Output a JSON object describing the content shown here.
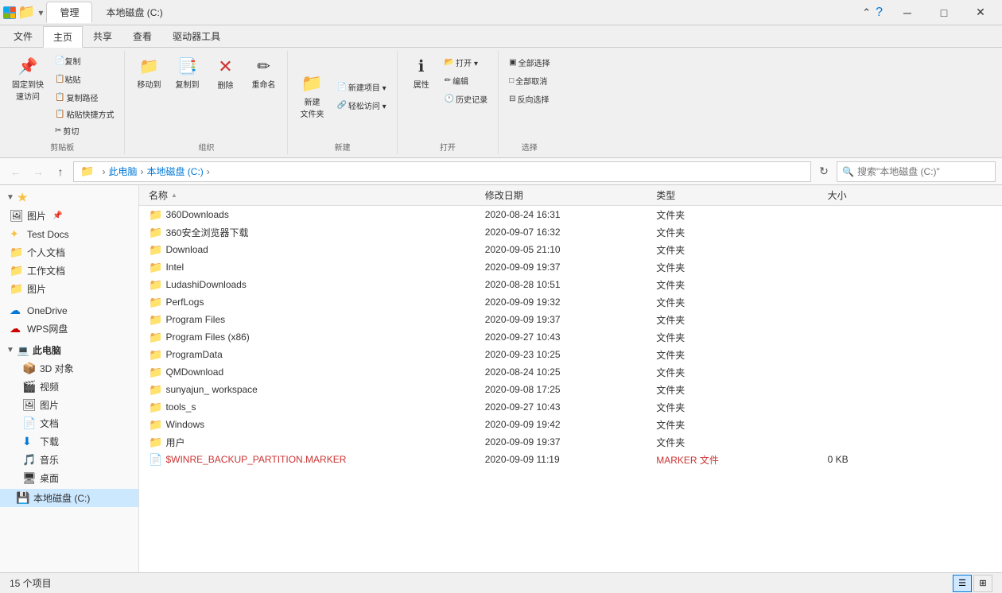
{
  "titleBar": {
    "tab1": "管理",
    "tab2": "本地磁盘 (C:)",
    "minimize": "─",
    "maximize": "□",
    "close": "✕",
    "helpIcon": "?"
  },
  "ribbonTabs": [
    "文件",
    "主页",
    "共享",
    "查看",
    "驱动器工具"
  ],
  "activeRibbonTab": "主页",
  "ribbonGroups": {
    "clipboard": {
      "label": "剪贴板",
      "items": [
        {
          "label": "固定到快速访问",
          "icon": "📌"
        },
        {
          "label": "复制",
          "icon": "📄"
        },
        {
          "label": "粘贴",
          "icon": "📋"
        },
        {
          "label": "剪切",
          "icon": "✂"
        }
      ],
      "secondary": [
        "复制路径",
        "粘贴快捷方式"
      ]
    },
    "organize": {
      "label": "组织",
      "items": [
        {
          "label": "移动到",
          "icon": "📁"
        },
        {
          "label": "复制到",
          "icon": "📑"
        },
        {
          "label": "删除",
          "icon": "✕"
        },
        {
          "label": "重命名",
          "icon": "✏"
        }
      ]
    },
    "new": {
      "label": "新建",
      "items": [
        {
          "label": "新建\n文件夹",
          "icon": "📁"
        },
        {
          "label": "新建项目▼",
          "icon": ""
        },
        {
          "label": "轻松访问▼",
          "icon": ""
        }
      ]
    },
    "open": {
      "label": "打开",
      "items": [
        {
          "label": "属性",
          "icon": "ℹ"
        },
        {
          "label": "打开▼",
          "icon": ""
        },
        {
          "label": "编辑",
          "icon": ""
        },
        {
          "label": "历史记录",
          "icon": ""
        }
      ]
    },
    "select": {
      "label": "选择",
      "items": [
        {
          "label": "全部选择",
          "icon": ""
        },
        {
          "label": "全部取消",
          "icon": ""
        },
        {
          "label": "反向选择",
          "icon": ""
        }
      ]
    }
  },
  "addressBar": {
    "back": "←",
    "forward": "→",
    "up": "↑",
    "path": [
      "此电脑",
      "本地磁盘 (C:)"
    ],
    "refresh": "↻",
    "searchPlaceholder": "搜索\"本地磁盘 (C:)\""
  },
  "sidebar": {
    "pinned": {
      "header": "★",
      "items": [
        "图片",
        "Test Docs"
      ]
    },
    "quickAccess": [
      "个人文档",
      "工作文档",
      "图片"
    ],
    "oneDrive": "OneDrive",
    "wpsNetDisk": "WPS网盘",
    "thisPC": {
      "label": "此电脑",
      "items": [
        "3D 对象",
        "视频",
        "图片",
        "文档",
        "下载",
        "音乐",
        "桌面"
      ]
    },
    "localDisk": "本地磁盘 (C:)"
  },
  "fileList": {
    "columns": [
      {
        "label": "名称",
        "sort": "▲"
      },
      {
        "label": "修改日期"
      },
      {
        "label": "类型"
      },
      {
        "label": "大小"
      }
    ],
    "files": [
      {
        "name": "360Downloads",
        "date": "2020-08-24 16:31",
        "type": "文件夹",
        "size": "",
        "isFolder": true
      },
      {
        "name": "360安全浏览器下载",
        "date": "2020-09-07 16:32",
        "type": "文件夹",
        "size": "",
        "isFolder": true
      },
      {
        "name": "Download",
        "date": "2020-09-05 21:10",
        "type": "文件夹",
        "size": "",
        "isFolder": true
      },
      {
        "name": "Intel",
        "date": "2020-09-09 19:37",
        "type": "文件夹",
        "size": "",
        "isFolder": true
      },
      {
        "name": "LudashiDownloads",
        "date": "2020-08-28 10:51",
        "type": "文件夹",
        "size": "",
        "isFolder": true
      },
      {
        "name": "PerfLogs",
        "date": "2020-09-09 19:32",
        "type": "文件夹",
        "size": "",
        "isFolder": true
      },
      {
        "name": "Program Files",
        "date": "2020-09-09 19:37",
        "type": "文件夹",
        "size": "",
        "isFolder": true
      },
      {
        "name": "Program Files (x86)",
        "date": "2020-09-27 10:43",
        "type": "文件夹",
        "size": "",
        "isFolder": true
      },
      {
        "name": "ProgramData",
        "date": "2020-09-23 10:25",
        "type": "文件夹",
        "size": "",
        "isFolder": true
      },
      {
        "name": "QMDownload",
        "date": "2020-08-24 10:25",
        "type": "文件夹",
        "size": "",
        "isFolder": true
      },
      {
        "name": "sunyajun_ workspace",
        "date": "2020-09-08 17:25",
        "type": "文件夹",
        "size": "",
        "isFolder": true
      },
      {
        "name": "tools_s",
        "date": "2020-09-27 10:43",
        "type": "文件夹",
        "size": "",
        "isFolder": true
      },
      {
        "name": "Windows",
        "date": "2020-09-09 19:42",
        "type": "文件夹",
        "size": "",
        "isFolder": true
      },
      {
        "name": "用户",
        "date": "2020-09-09 19:37",
        "type": "文件夹",
        "size": "",
        "isFolder": true
      },
      {
        "name": "$WINRE_BACKUP_PARTITION.MARKER",
        "date": "2020-09-09 11:19",
        "type": "MARKER 文件",
        "size": "0 KB",
        "isFolder": false,
        "isMarker": true
      }
    ]
  },
  "statusBar": {
    "itemCount": "15 个项目"
  }
}
